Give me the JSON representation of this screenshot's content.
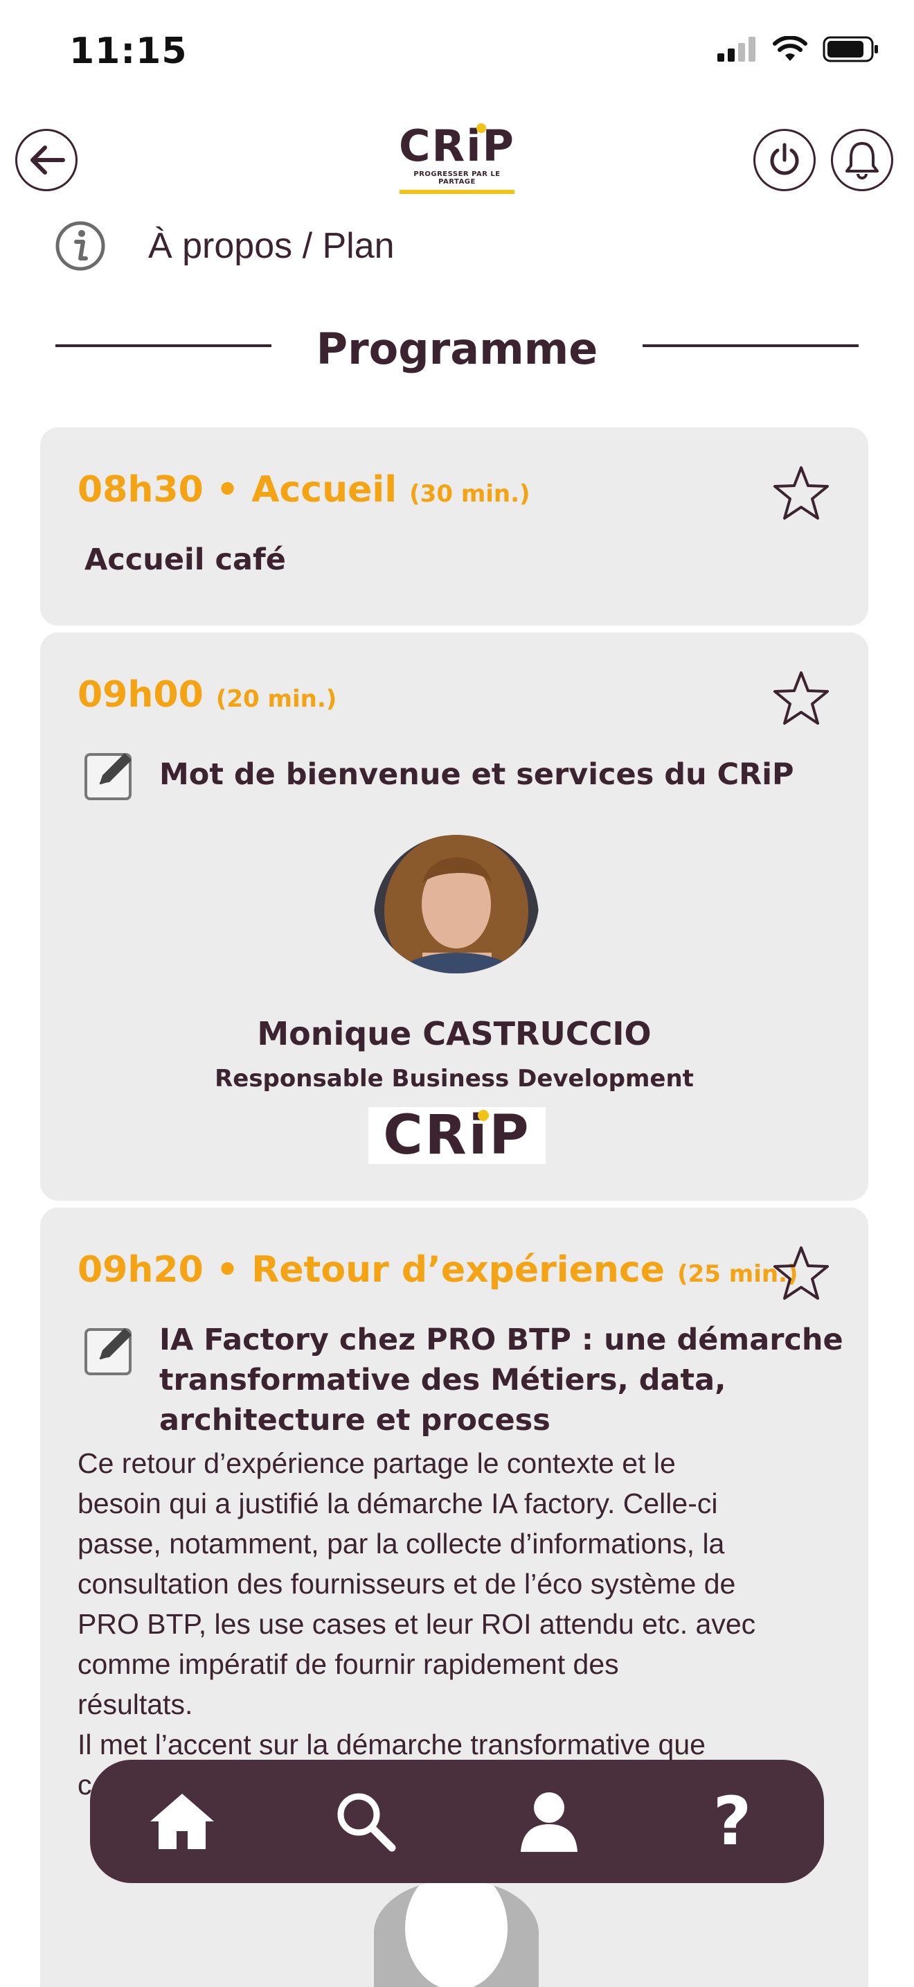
{
  "status_bar": {
    "time": "11:15"
  },
  "header": {
    "logo_text": "CRiP",
    "logo_tagline": "PROGRESSER PAR LE PARTAGE",
    "about_label": "À propos / Plan"
  },
  "section_title": "Programme",
  "sessions": [
    {
      "time": "08h30 • Accueil",
      "duration": "(30 min.)",
      "title": "Accueil café"
    },
    {
      "time": "09h00",
      "duration": "(20 min.)",
      "title": "Mot de bienvenue et services du CRiP",
      "speaker": {
        "name": "Monique CASTRUCCIO",
        "role": "Responsable Business Development",
        "company_logo": "CRiP"
      }
    },
    {
      "time": "09h20 • Retour d’expérience",
      "duration": "(25 min.)",
      "title_lines": [
        "IA Factory chez PRO BTP : une démarche",
        "transformative des Métiers, data,",
        "architecture et process"
      ],
      "description_lines": [
        "Ce retour d’expérience partage le contexte et le",
        "besoin qui a justifié la démarche IA factory. Celle-ci",
        "passe, notamment, par la collecte d’informations, la",
        "consultation des fournisseurs et de l’éco système de",
        "PRO BTP, les use cases et leur ROI attendu etc. avec",
        "comme impératif de fournir rapidement des",
        "résultats.",
        "Il met l’accent sur la démarche transformative que",
        "c"
      ]
    }
  ],
  "bottom_nav": {
    "items": [
      "home-icon",
      "search-icon",
      "user-icon",
      "help-icon"
    ],
    "help_label": "?"
  },
  "colors": {
    "accent": "#f4a313",
    "brand": "#3b2330",
    "nav_bg": "#4a2f3c",
    "card_bg": "#ececec",
    "logo_yellow": "#f2c216"
  }
}
